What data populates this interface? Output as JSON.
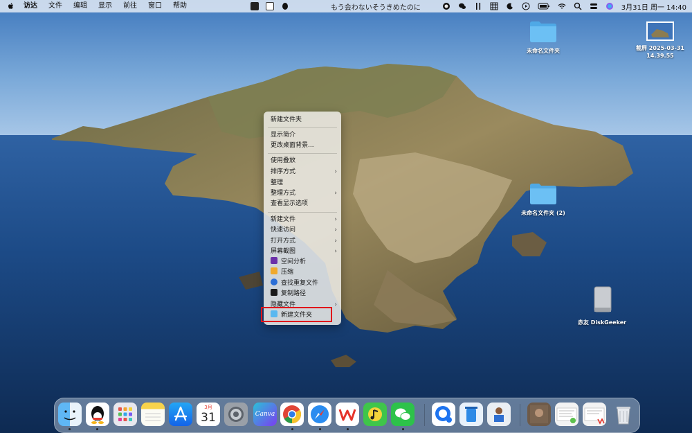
{
  "menubar": {
    "app_name": "访达",
    "menus": [
      "文件",
      "编辑",
      "显示",
      "前往",
      "窗口",
      "帮助"
    ],
    "now_playing": "もう会わないそうきめたのに",
    "datetime": "3月31日 周一 14:40"
  },
  "desktop_icons": {
    "folder1": "未命名文件夹",
    "screenshot": "截屏 2025-03-31 14.39.55",
    "folder2": "未命名文件夹 (2)",
    "disk": "赤友 DiskGeeker"
  },
  "context_menu": {
    "new_folder": "新建文件夹",
    "get_info": "显示简介",
    "change_bg": "更改桌面背景...",
    "use_stacks": "使用叠放",
    "sort_by": "排序方式",
    "clean_up": "整理",
    "clean_up_by": "整理方式",
    "view_options": "查看显示选项",
    "new_file": "新建文件",
    "quick_access": "快速访问",
    "open_with": "打开方式",
    "screenshot": "屏幕截图",
    "space_analysis": "空间分析",
    "compress": "压缩",
    "find_dupes": "查找重复文件",
    "copy_path": "复制路径",
    "hidden_files": "隐藏文件",
    "new_folder_ext": "新建文件夹"
  },
  "dock": {
    "calendar_month": "3月",
    "calendar_day": "31",
    "canva_label": "Canva"
  },
  "colors": {
    "highlight": "#e0151b",
    "folder": "#5ab8f0"
  }
}
